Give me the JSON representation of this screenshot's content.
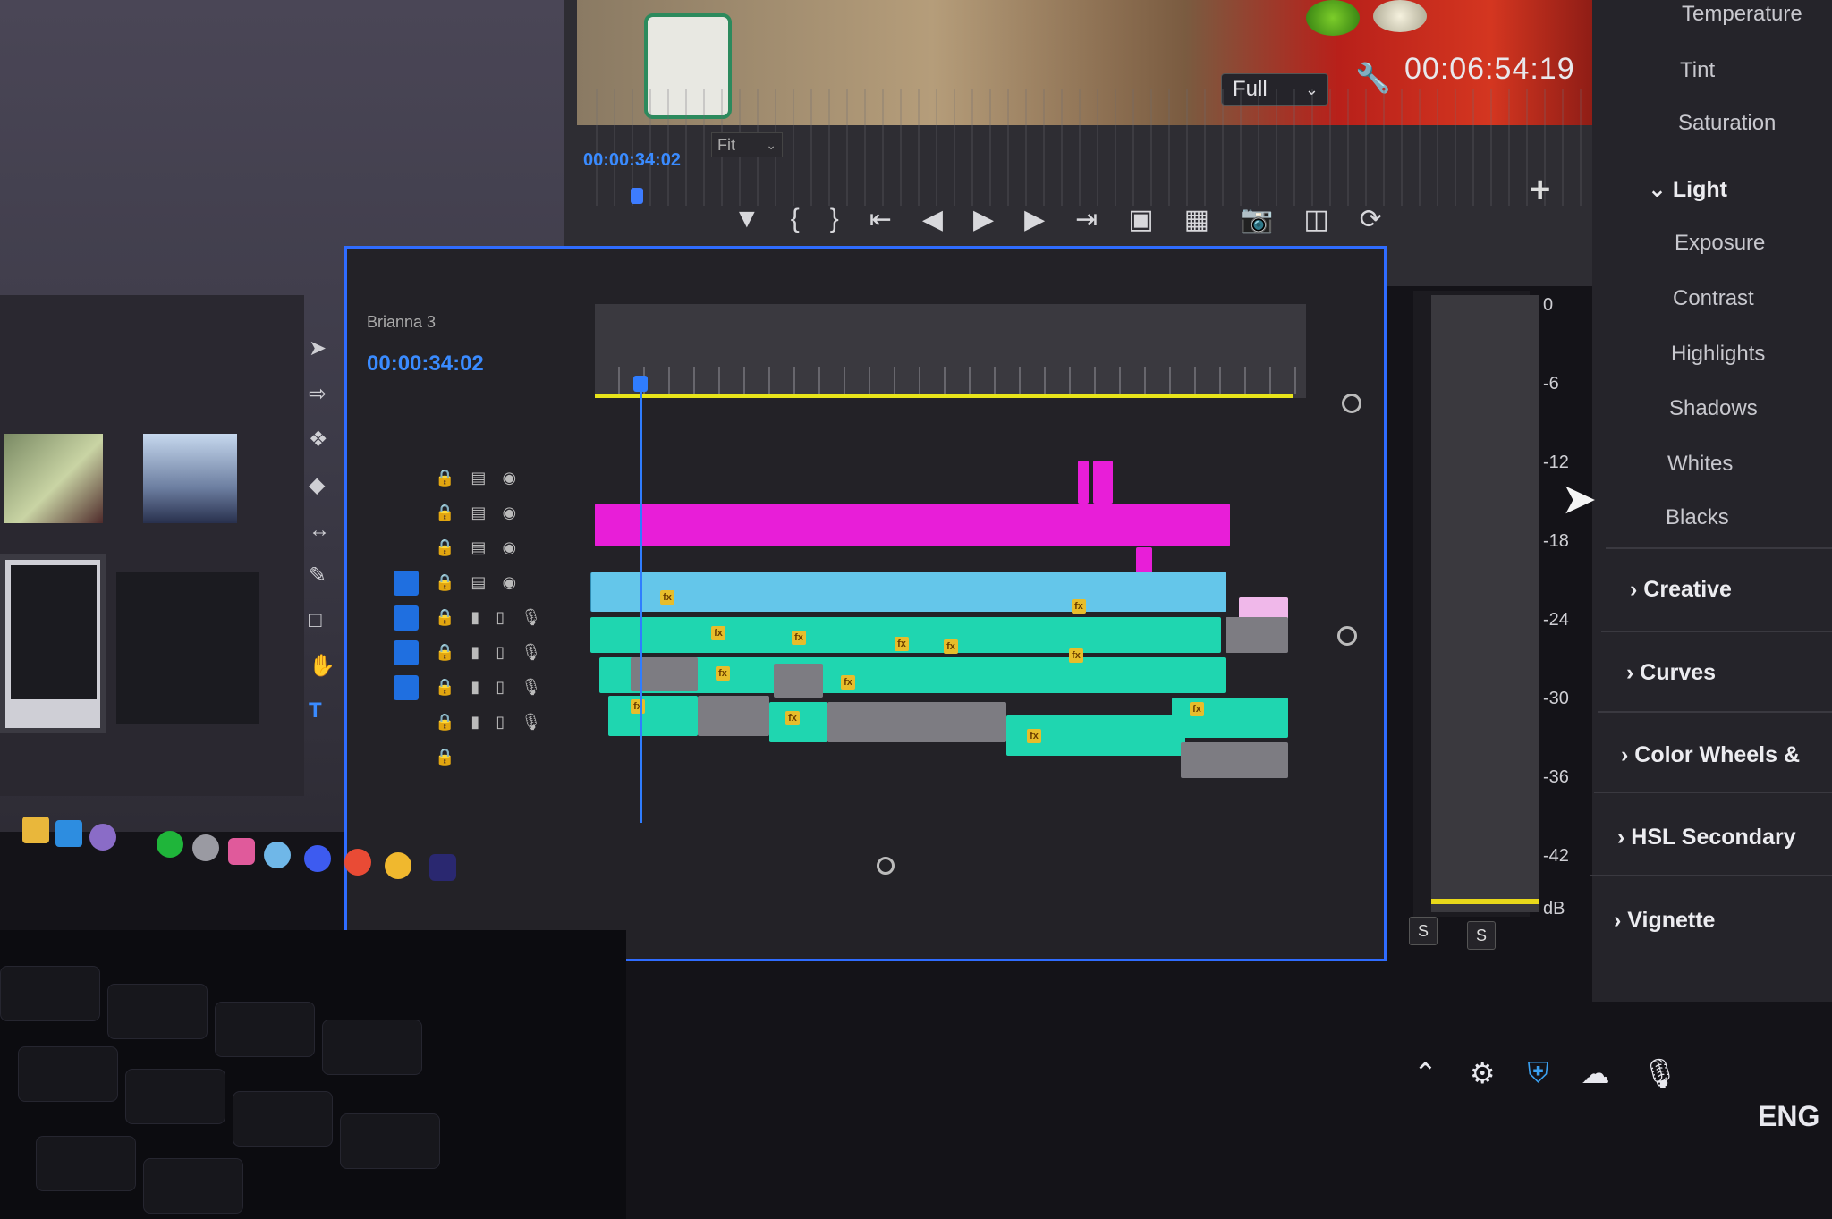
{
  "program_monitor": {
    "zoom": "Full",
    "timecode_duration": "00:06:54:19",
    "timecode_current": "00:00:34:02",
    "fit": "Fit",
    "icons": [
      "wrench-icon",
      "mark-in-icon",
      "go-to-in-icon",
      "step-back-icon",
      "play-icon",
      "step-forward-icon",
      "go-to-out-icon",
      "lift-icon",
      "extract-icon",
      "camera-icon",
      "compare-icon",
      "loop-icon",
      "add-icon"
    ]
  },
  "timeline": {
    "sequence_name": "Brianna 3",
    "timecode": "00:00:34:02"
  },
  "audio_meter": {
    "scale": [
      "0",
      "-6",
      "-12",
      "-18",
      "-24",
      "-30",
      "-36",
      "-42",
      "dB"
    ],
    "solo_left": "S",
    "solo_right": "S"
  },
  "lumetri": {
    "basic_items": [
      "Temperature",
      "Tint",
      "Saturation"
    ],
    "light_section": "Light",
    "light_items": [
      "Exposure",
      "Contrast",
      "Highlights",
      "Shadows",
      "Whites",
      "Blacks"
    ],
    "sections": [
      "Creative",
      "Curves",
      "Color Wheels &",
      "HSL Secondary",
      "Vignette"
    ]
  },
  "tray": {
    "language": "ENG"
  },
  "colors": {
    "accent_blue": "#2f6cff",
    "video_clip": "#64c6ea",
    "audio_clip": "#1fd6b0",
    "graphic_clip": "#e81ed8",
    "work_area": "#e8e41a"
  }
}
